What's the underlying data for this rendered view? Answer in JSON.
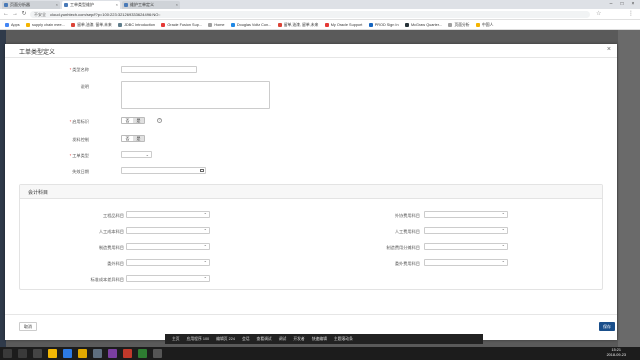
{
  "browser": {
    "tabs": [
      {
        "label": "页面分析器"
      },
      {
        "label": "工单类型维护"
      },
      {
        "label": "维护工单定义"
      }
    ],
    "address": {
      "security": "不安全",
      "url": "cloud.yunhtech.com/sep/f?p=100:223:321269333624496:NO::"
    },
    "bookmarks": [
      "Apps",
      "supply chain mee...",
      "留单,油漆, 留单,未来",
      "JDBC Introduction",
      "Oracle Fusion Sup...",
      "Home",
      "Douglas Voltz Con...",
      "留单,油漆, 留单,未来",
      "My Oracle Support",
      "PROD Sign In",
      "McGraw Quarter...",
      "页面分析",
      "中国人"
    ]
  },
  "modal": {
    "title": "工单类型定义",
    "close": "×",
    "fields": {
      "type_name": "类型名称",
      "description": "说明",
      "enabled": "启用标识",
      "issue_control": "发料控制",
      "work_order_type": "工单类型",
      "expiry_date": "失效日期"
    },
    "toggle_no": "否",
    "toggle_yes": "是",
    "help": "?",
    "accounts": {
      "title": "会计科目",
      "left": [
        "工程品科目",
        "人工成本科目",
        "制造费用科目",
        "委外科目",
        "标准成本差异科目"
      ],
      "right": [
        "外协费用科目",
        "人工费用科目",
        "制造费用分摊科目",
        "委外费用科目"
      ]
    },
    "cancel": "取消",
    "save": "保存"
  },
  "apptool": [
    "主页",
    "应用程序 100",
    "编辑页 224",
    "会话",
    "查看调试",
    "调试",
    "开发者",
    "快速编辑",
    "主题滚动条"
  ],
  "clock": {
    "time": "15:21",
    "date": "2018-09-23"
  }
}
